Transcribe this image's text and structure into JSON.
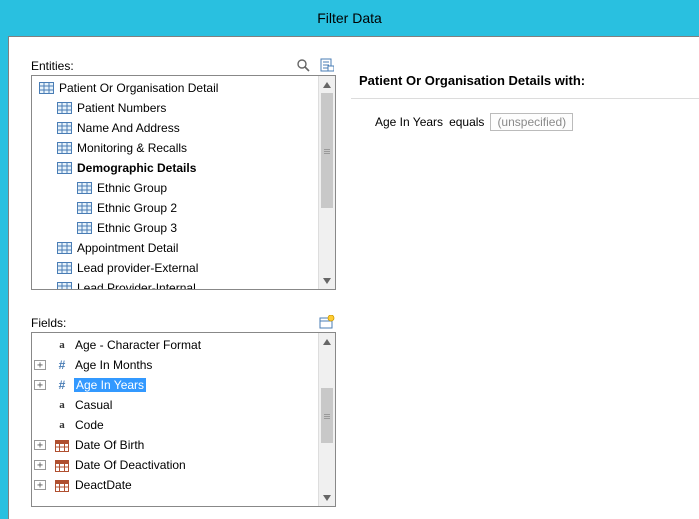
{
  "window": {
    "title": "Filter Data"
  },
  "entities": {
    "label": "Entities:",
    "root": "Patient Or Organisation Detail",
    "children": {
      "c0": "Patient Numbers",
      "c1": "Name And Address",
      "c2": "Monitoring & Recalls",
      "c3": "Demographic Details",
      "c3a": "Ethnic Group",
      "c3b": "Ethnic Group 2",
      "c3c": "Ethnic Group 3",
      "c4": "Appointment Detail",
      "c5": "Lead provider-External",
      "c6": "Lead Provider-Internal"
    }
  },
  "fields": {
    "label": "Fields:",
    "items": {
      "f0": "Age - Character Format",
      "f1": "Age In Months",
      "f2": "Age In Years",
      "f3": "Casual",
      "f4": "Code",
      "f5": "Date Of Birth",
      "f6": "Date Of Deactivation",
      "f7": "DeactDate"
    },
    "selected": "f2"
  },
  "filter": {
    "heading": "Patient Or Organisation Details with:",
    "field": "Age In Years",
    "operator": "equals",
    "value_placeholder": "(unspecified)"
  },
  "icons": {
    "search": "search-icon",
    "props": "properties-icon",
    "newfield": "new-field-icon"
  }
}
